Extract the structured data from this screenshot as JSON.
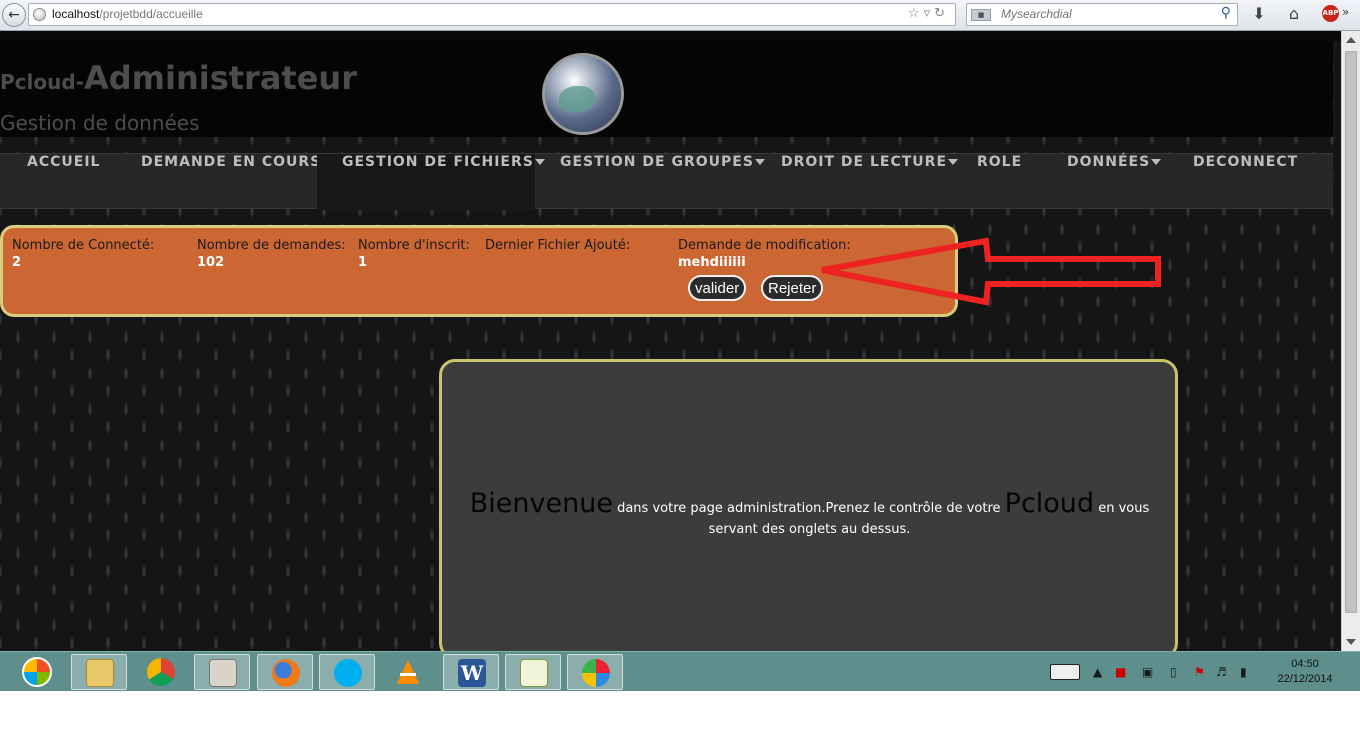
{
  "browser": {
    "url_host": "localhost",
    "url_path": "/projetbdd/accueille",
    "search_placeholder": "Mysearchdial",
    "abp_label": "ABP"
  },
  "header": {
    "brand_prefix": "Pcloud-",
    "brand_main": "Administrateur",
    "subtitle": "Gestion de données"
  },
  "menu": {
    "items": [
      {
        "label": "ACCUEIL"
      },
      {
        "label": "DEMANDE EN COURS"
      },
      {
        "label": "GESTION DE FICHIERS"
      },
      {
        "label": "GESTION DE GROUPES"
      },
      {
        "label": "DROIT DE LECTURE"
      },
      {
        "label": "ROLE"
      },
      {
        "label": "DONNÉES"
      },
      {
        "label": "DECONNECT"
      }
    ]
  },
  "stats": {
    "connected_label": "Nombre de Connecté:",
    "connected_value": "2",
    "requests_label": "Nombre de demandes:",
    "requests_value": "102",
    "registered_label": "Nombre d'inscrit:",
    "registered_value": "1",
    "last_file_label": "Dernier Fichier Ajouté:",
    "last_file_value": "",
    "modif_label": "Demande de modification:",
    "modif_value": "mehdiiiiii",
    "validate_label": "valider",
    "reject_label": "Rejeter"
  },
  "welcome": {
    "big_word_1": "Bienvenue",
    "text_1": " dans votre page administration.Prenez le contrôle de votre ",
    "big_word_2": "Pcloud",
    "text_2": " en vous servant des onglets au dessus."
  },
  "taskbar": {
    "time": "04:50",
    "date": "22/12/2014"
  },
  "colors": {
    "stats_panel": "#cc6633",
    "panel_border": "#d9cc7a",
    "welcome_bg": "#3c3c3c",
    "arrow": "#ee2222",
    "taskbar": "#5f8f8c"
  },
  "icons": {
    "browser": [
      "back-arrow-icon",
      "site-globe-icon",
      "bookmark-star-icon",
      "dropdown-icon",
      "reload-icon",
      "search-magnifier-icon",
      "download-icon",
      "home-icon",
      "adblock-icon"
    ],
    "taskbar": [
      "windows-start-icon",
      "file-explorer-icon",
      "chrome-icon",
      "control-panel-icon",
      "firefox-icon",
      "skype-icon",
      "vlc-icon",
      "word-icon",
      "notepadpp-icon",
      "paint-icon"
    ],
    "tray": [
      "keyboard-icon",
      "show-hidden-icons-icon",
      "acrobat-icon",
      "action-center-icon",
      "battery-icon",
      "network-flag-icon",
      "volume-icon",
      "signal-icon"
    ]
  }
}
